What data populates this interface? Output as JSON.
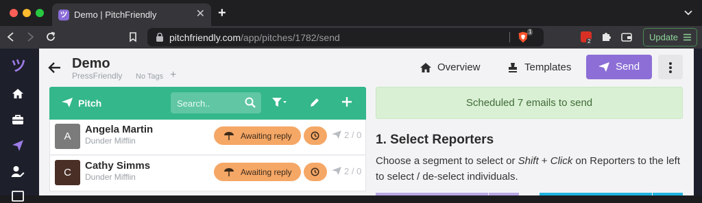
{
  "browser": {
    "tab_title": "Demo | PitchFriendly",
    "tab_favicon": "ツ",
    "close_glyph": "✕",
    "newtab_glyph": "+",
    "url_host": "pitchfriendly.com",
    "url_path": "/app/pitches/1782/send",
    "brave_badge": "1",
    "ext_badge": "2",
    "update_label": "Update"
  },
  "app": {
    "logo": "ツ",
    "title": "Demo",
    "subtitle": "PressFriendly",
    "tags_label": "No Tags",
    "add_tag": "+",
    "nav": {
      "overview": "Overview",
      "templates": "Templates",
      "send": "Send"
    },
    "pitch_panel": {
      "title": "Pitch",
      "search_placeholder": "Search..",
      "rows": [
        {
          "initial": "A",
          "name": "Angela Martin",
          "company": "Dunder Mifflin",
          "status": "Awaiting reply",
          "counts": "2 / 0",
          "avatar_color": "#7b7b7b"
        },
        {
          "initial": "C",
          "name": "Cathy Simms",
          "company": "Dunder Mifflin",
          "status": "Awaiting reply",
          "counts": "2 / 0",
          "avatar_color": "#4a2f26"
        }
      ]
    },
    "alert": "Scheduled 7 emails to send",
    "step": {
      "title": "1. Select Reporters",
      "desc_1": "Choose a segment to select or ",
      "desc_shift": "Shift",
      "desc_2": " + ",
      "desc_click": "Click",
      "desc_3": " on Reporters to the left to select / de-select individuals."
    }
  },
  "colors": {
    "accent_purple": "#8c6ed6",
    "pitch_green": "#34b78a",
    "status_orange": "#f5a766",
    "alert_green_bg": "#daf0d4"
  }
}
